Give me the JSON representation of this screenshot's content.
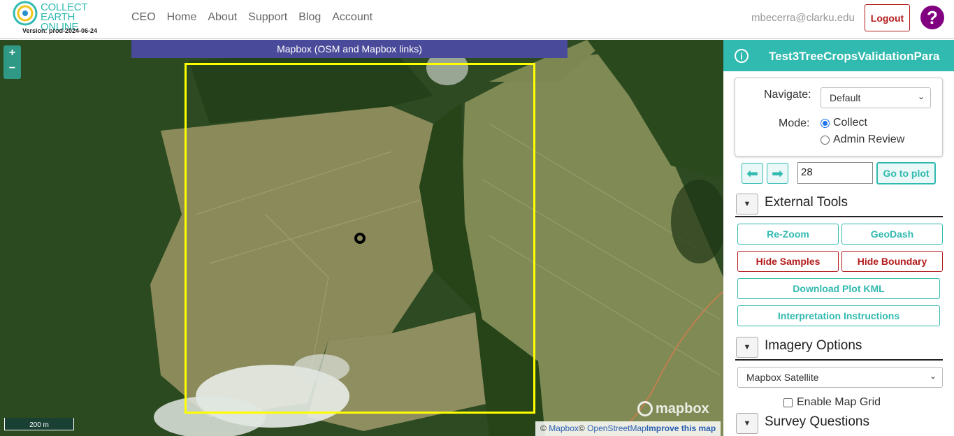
{
  "app": {
    "logo_line1": "COLLECT EARTH",
    "logo_line2": "ONLINE",
    "version": "Version: prod-2024-06-24"
  },
  "nav": {
    "links": [
      "CEO",
      "Home",
      "About",
      "Support",
      "Blog",
      "Account"
    ],
    "user_email": "mbecerra@clarku.edu",
    "logout_label": "Logout",
    "help_glyph": "?"
  },
  "map": {
    "imagery_banner": "Mapbox (OSM and Mapbox links)",
    "zoom_in": "+",
    "zoom_out": "−",
    "scale_label": "200 m",
    "mapbox_logo": "mapbox",
    "attribution_copy1": "©",
    "attribution_mapbox": "Mapbox",
    "attribution_copy2": "©",
    "attribution_osm": "OpenStreetMap",
    "attribution_improve": "Improve this map",
    "plot_box_color": "#ffff00"
  },
  "panel": {
    "title": "Test3TreeCropsValidationPara",
    "info_glyph": "i",
    "navigate_label": "Navigate:",
    "navigate_value": "Default",
    "mode_label": "Mode:",
    "mode_options": [
      "Collect",
      "Admin Review"
    ],
    "mode_selected": "Collect",
    "prev_glyph": "⬅",
    "next_glyph": "➡",
    "plot_number": "28",
    "goto_label": "Go to plot",
    "external_tools_title": "External Tools",
    "rezoom_label": "Re-Zoom",
    "geodash_label": "GeoDash",
    "hide_samples_label": "Hide Samples",
    "hide_boundary_label": "Hide Boundary",
    "download_kml_label": "Download Plot KML",
    "instructions_label": "Interpretation Instructions",
    "imagery_options_title": "Imagery Options",
    "imagery_value": "Mapbox Satellite",
    "map_grid_label": "Enable Map Grid",
    "survey_questions_title": "Survey Questions",
    "accent_color": "#31bab0",
    "danger_color": "#b31b1b"
  }
}
